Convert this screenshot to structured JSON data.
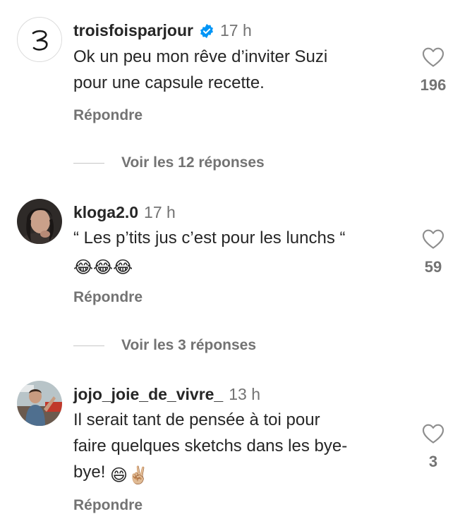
{
  "comments": [
    {
      "username": "troisfoisparjour",
      "verified": true,
      "time": "17 h",
      "text_lines": [
        "Ok un peu mon rêve d’inviter Suzi",
        "pour une capsule recette."
      ],
      "emojis": "",
      "likes": "196",
      "reply_label": "Répondre",
      "view_replies": "Voir les 12 réponses",
      "avatar_icon": "script-z-logo"
    },
    {
      "username": "kloga2.0",
      "verified": false,
      "time": "17 h",
      "text_lines": [
        "“ Les p’tits jus c’est pour les lunchs “"
      ],
      "emojis": "😂😂😂",
      "likes": "59",
      "reply_label": "Répondre",
      "view_replies": "Voir les 3 réponses",
      "avatar_icon": "profile-photo"
    },
    {
      "username": "jojo_joie_de_vivre_",
      "verified": false,
      "time": "13 h",
      "text_lines": [
        "Il serait tant de pensée à toi pour",
        "faire quelques sketchs dans les bye-",
        "bye!"
      ],
      "emojis": "😄✌🏼",
      "likes": "3",
      "reply_label": "Répondre",
      "avatar_icon": "profile-photo"
    }
  ],
  "colors": {
    "text": "#262626",
    "secondary": "#737373",
    "verified": "#0095f6",
    "divider": "#c7c7c7"
  }
}
